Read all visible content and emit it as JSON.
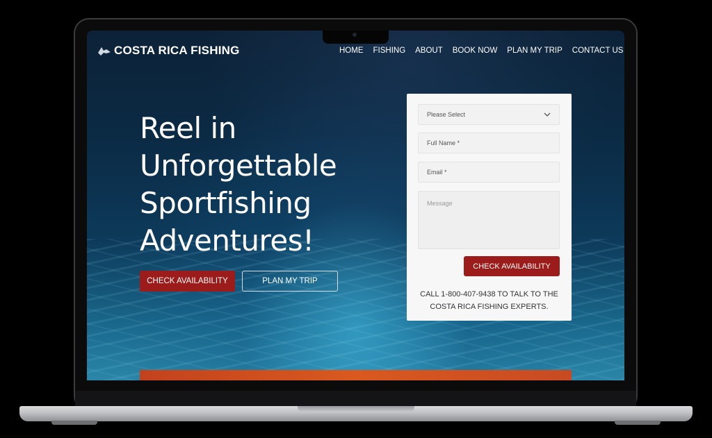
{
  "brand": {
    "name": "COSTA RICA FISHING",
    "logo_icon": "sailfish-icon"
  },
  "nav": {
    "items": [
      "HOME",
      "FISHING",
      "ABOUT",
      "BOOK NOW",
      "PLAN  MY TRIP",
      "CONTACT US"
    ]
  },
  "hero": {
    "title": "Reel in Unforgettable Sportfishing Adventures!",
    "primary_button": "CHECK AVAILABILITY",
    "secondary_button": "PLAN MY TRIP"
  },
  "form": {
    "select_placeholder": "Please Select",
    "name_placeholder": "Full Name *",
    "email_placeholder": "Email *",
    "message_placeholder": "Message",
    "submit_label": "CHECK AVAILABILITY",
    "call_text": "CALL 1-800-407-9438 TO TALK TO THE COSTA RICA FISHING EXPERTS."
  },
  "colors": {
    "accent_red": "#9b1c1a",
    "ocean_dark": "#0b2a44",
    "strip_orange": "#d9591f"
  }
}
